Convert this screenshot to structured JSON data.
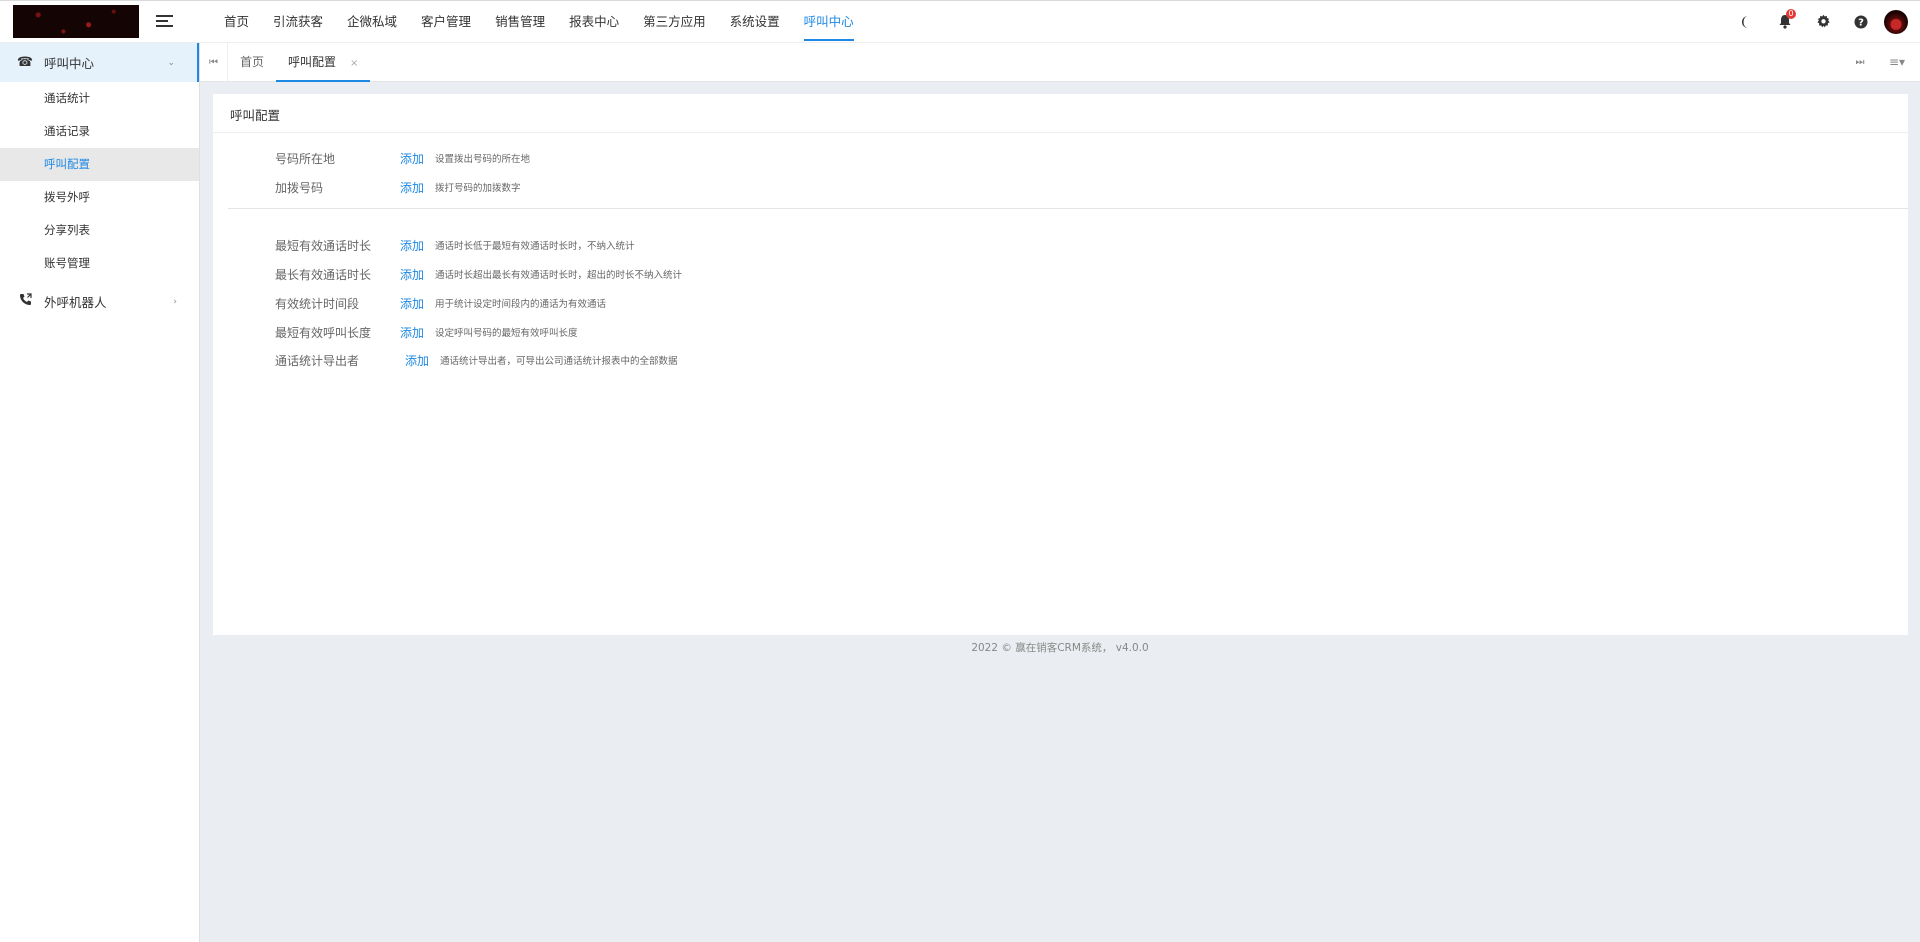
{
  "header": {
    "logo_alt": "",
    "nav": [
      "首页",
      "引流获客",
      "企微私域",
      "客户管理",
      "销售管理",
      "报表中心",
      "第三方应用",
      "系统设置",
      "呼叫中心"
    ],
    "active_nav": 8,
    "notification_count": "0",
    "icons": [
      "moon-icon",
      "bell-icon",
      "gear-icon",
      "help-icon"
    ]
  },
  "sidebar": {
    "groups": [
      {
        "label": "呼叫中心",
        "icon": "phone-icon",
        "expanded": true,
        "items": [
          "通话统计",
          "通话记录",
          "呼叫配置",
          "拨号外呼",
          "分享列表",
          "账号管理"
        ],
        "active_item": 2
      },
      {
        "label": "外呼机器人",
        "icon": "phone-outgoing-icon",
        "expanded": false
      }
    ]
  },
  "tabbar": {
    "tabs": [
      {
        "label": "首页"
      },
      {
        "label": "呼叫配置",
        "closable": true
      }
    ],
    "active_tab": 1,
    "close_glyph": "×"
  },
  "card": {
    "title": "呼叫配置",
    "section1": [
      {
        "label": "号码所在地",
        "action": "添加",
        "desc": "设置拨出号码的所在地"
      },
      {
        "label": "加拨号码",
        "action": "添加",
        "desc": "拨打号码的加拨数字"
      }
    ],
    "section2": [
      {
        "label": "最短有效通话时长",
        "action": "添加",
        "desc": "通话时长低于最短有效通话时长时，不纳入统计"
      },
      {
        "label": "最长有效通话时长",
        "action": "添加",
        "desc": "通话时长超出最长有效通话时长时，超出的时长不纳入统计"
      },
      {
        "label": "有效统计时间段",
        "action": "添加",
        "desc": "用于统计设定时间段内的通话为有效通话"
      },
      {
        "label": "最短有效呼叫长度",
        "action": "添加",
        "desc": "设定呼叫号码的最短有效呼叫长度"
      },
      {
        "label": "通话统计导出者",
        "action": "添加",
        "desc": "通话统计导出者，可导出公司通话统计报表中的全部数据"
      }
    ]
  },
  "footer": {
    "text": "2022 © 赢在销客CRM系统， v4.0.0"
  },
  "colors": {
    "accent": "#1e88e5",
    "page_bg": "#eaedf1",
    "badge": "#e53935"
  }
}
